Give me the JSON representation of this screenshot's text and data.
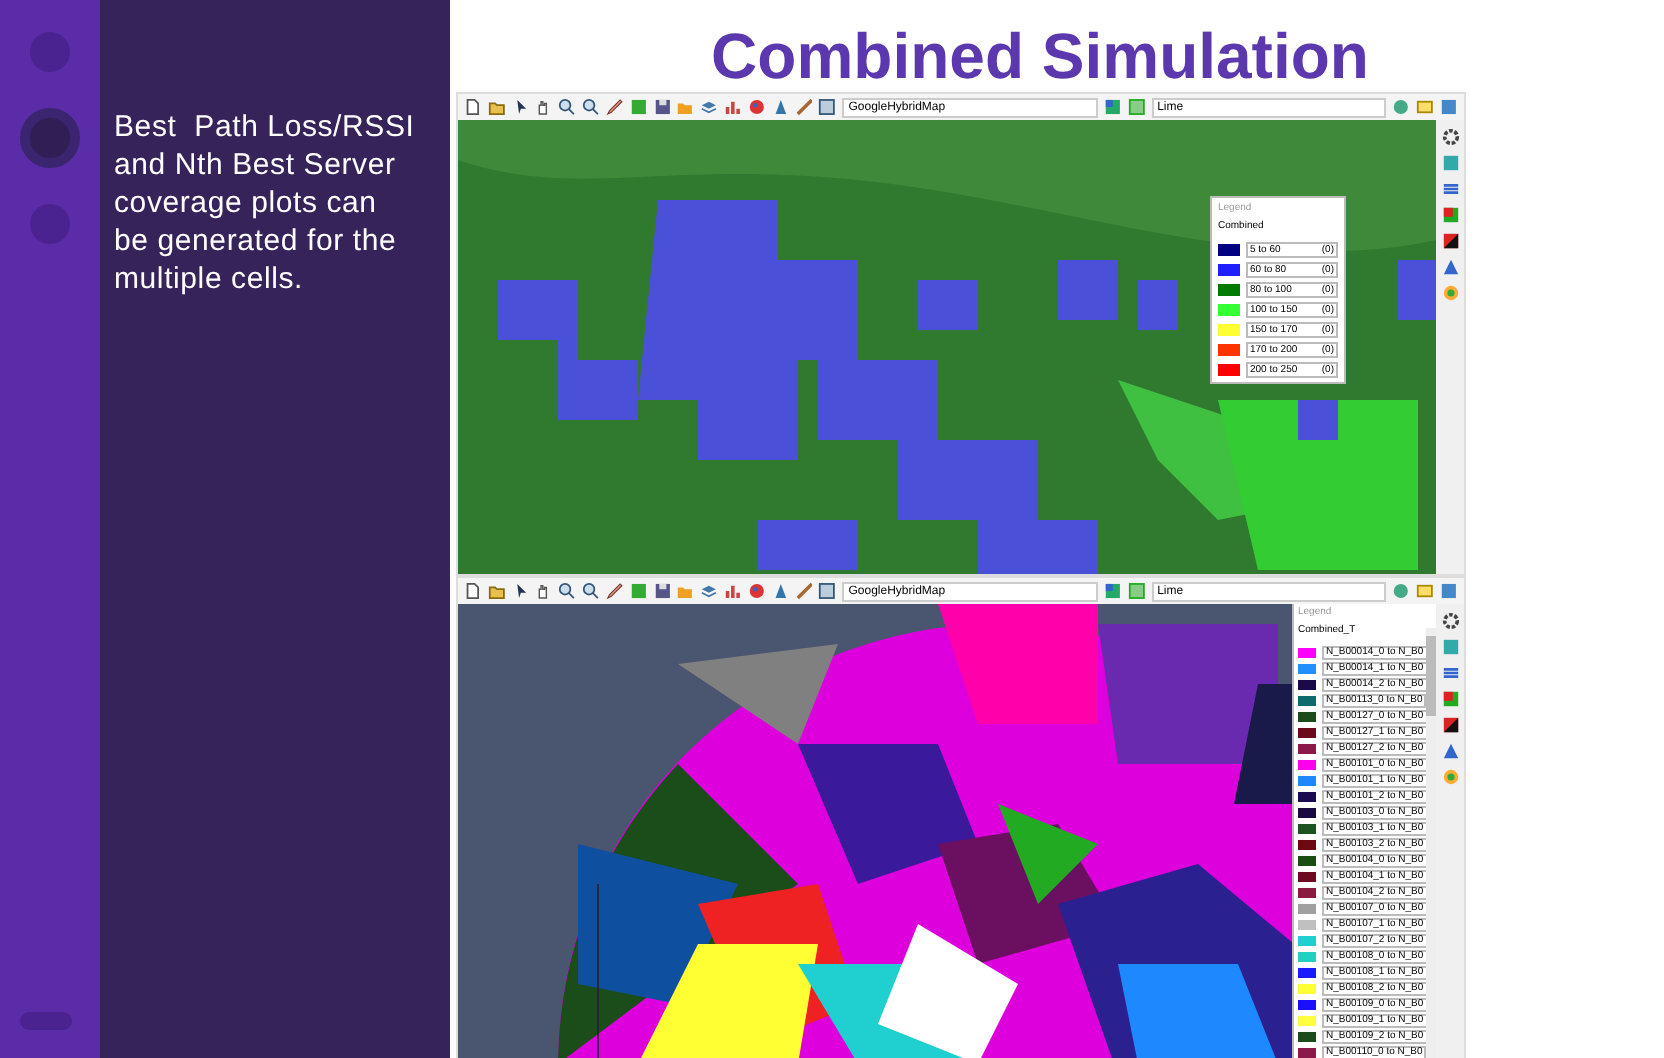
{
  "sidebar": {
    "text": "Best  Path Loss/RSSI and Nth Best Server coverage plots can be generated for the multiple cells."
  },
  "title": "Combined Simulation",
  "panels": [
    {
      "kind": "pathloss",
      "toolbar": {
        "map_source": "GoogleHybridMap",
        "color_scheme": "Lime"
      },
      "legend": {
        "title": "Legend",
        "layer": "Combined",
        "items": [
          {
            "label": "5 to 60",
            "count": "(0)",
            "color": "#000080"
          },
          {
            "label": "60 to 80",
            "count": "(0)",
            "color": "#1f1fff"
          },
          {
            "label": "80 to 100",
            "count": "(0)",
            "color": "#007a00"
          },
          {
            "label": "100 to 150",
            "count": "(0)",
            "color": "#33ff33"
          },
          {
            "label": "150 to 170",
            "count": "(0)",
            "color": "#ffff33"
          },
          {
            "label": "170 to 200",
            "count": "(0)",
            "color": "#ff3300"
          },
          {
            "label": "200 to 250",
            "count": "(0)",
            "color": "#ff0000"
          }
        ]
      }
    },
    {
      "kind": "bestserver",
      "toolbar": {
        "map_source": "GoogleHybridMap",
        "color_scheme": "Lime"
      },
      "legend": {
        "title": "Legend",
        "layer": "Combined_T",
        "items": [
          {
            "label": "N_B00014_0 to N_B0",
            "color": "#ff00ff"
          },
          {
            "label": "N_B00014_1 to N_B0",
            "color": "#1e90ff"
          },
          {
            "label": "N_B00014_2 to N_B0",
            "color": "#1a0a4a"
          },
          {
            "label": "N_B00113_0 to N_B0",
            "color": "#0f6b6b"
          },
          {
            "label": "N_B00127_0 to N_B0",
            "color": "#1a4d1a"
          },
          {
            "label": "N_B00127_1 to N_B0",
            "color": "#6b0a1a"
          },
          {
            "label": "N_B00127_2 to N_B0",
            "color": "#8b1a4a"
          },
          {
            "label": "N_B00101_0 to N_B0",
            "color": "#ff00ee"
          },
          {
            "label": "N_B00101_1 to N_B0",
            "color": "#1e88ff"
          },
          {
            "label": "N_B00101_2 to N_B0",
            "color": "#1a0a50"
          },
          {
            "label": "N_B00103_0 to N_B0",
            "color": "#1a0a44"
          },
          {
            "label": "N_B00103_1 to N_B0",
            "color": "#1a5520"
          },
          {
            "label": "N_B00103_2 to N_B0",
            "color": "#6b0a10"
          },
          {
            "label": "N_B00104_0 to N_B0",
            "color": "#1a4d10"
          },
          {
            "label": "N_B00104_1 to N_B0",
            "color": "#6b0a20"
          },
          {
            "label": "N_B00104_2 to N_B0",
            "color": "#8b1a40"
          },
          {
            "label": "N_B00107_0 to N_B0",
            "color": "#a0a0a0"
          },
          {
            "label": "N_B00107_1 to N_B0",
            "color": "#c0c0c0"
          },
          {
            "label": "N_B00107_2 to N_B0",
            "color": "#20d0d0"
          },
          {
            "label": "N_B00108_0 to N_B0",
            "color": "#20d0c0"
          },
          {
            "label": "N_B00108_1 to N_B0",
            "color": "#1a1aff"
          },
          {
            "label": "N_B00108_2 to N_B0",
            "color": "#ffff33"
          },
          {
            "label": "N_B00109_0 to N_B0",
            "color": "#1a10ff"
          },
          {
            "label": "N_B00109_1 to N_B0",
            "color": "#ffff40"
          },
          {
            "label": "N_B00109_2 to N_B0",
            "color": "#1a4d1a"
          },
          {
            "label": "N_B00110_0 to N_B0",
            "color": "#8b1a4a"
          }
        ]
      }
    }
  ]
}
